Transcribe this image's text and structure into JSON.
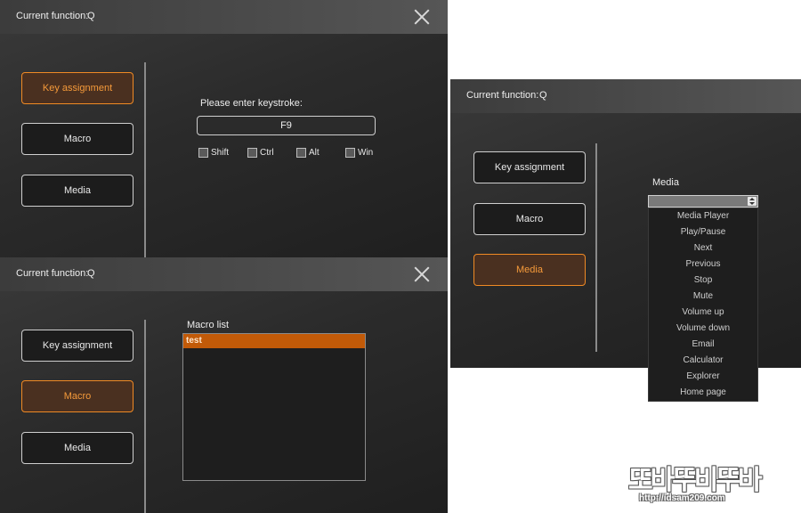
{
  "window_key": {
    "title_label": "Current function:",
    "title_value": "Q",
    "sidebar": [
      "Key assignment",
      "Macro",
      "Media"
    ],
    "active": "Key assignment",
    "keystroke_label": "Please enter keystroke:",
    "keystroke_value": "F9",
    "modifiers": [
      "Shift",
      "Ctrl",
      "Alt",
      "Win"
    ]
  },
  "window_macro": {
    "title_label": "Current function:",
    "title_value": "Q",
    "sidebar": [
      "Key assignment",
      "Macro",
      "Media"
    ],
    "active": "Macro",
    "list_label": "Macro list",
    "list_items": [
      "test"
    ]
  },
  "window_media": {
    "title_label": "Current function:",
    "title_value": "Q",
    "sidebar": [
      "Key assignment",
      "Macro",
      "Media"
    ],
    "active": "Media",
    "media_label": "Media",
    "dropdown_options": [
      "Media Player",
      "Play/Pause",
      "Next",
      "Previous",
      "Stop",
      "Mute",
      "Volume up",
      "Volume down",
      "Email",
      "Calculator",
      "Explorer",
      "Home page"
    ]
  },
  "watermark": {
    "text": "또바뚜비뚜바",
    "url": "http://idsam209.com"
  },
  "colors": {
    "accent": "#f08a24",
    "selected_row": "#c25a08"
  }
}
